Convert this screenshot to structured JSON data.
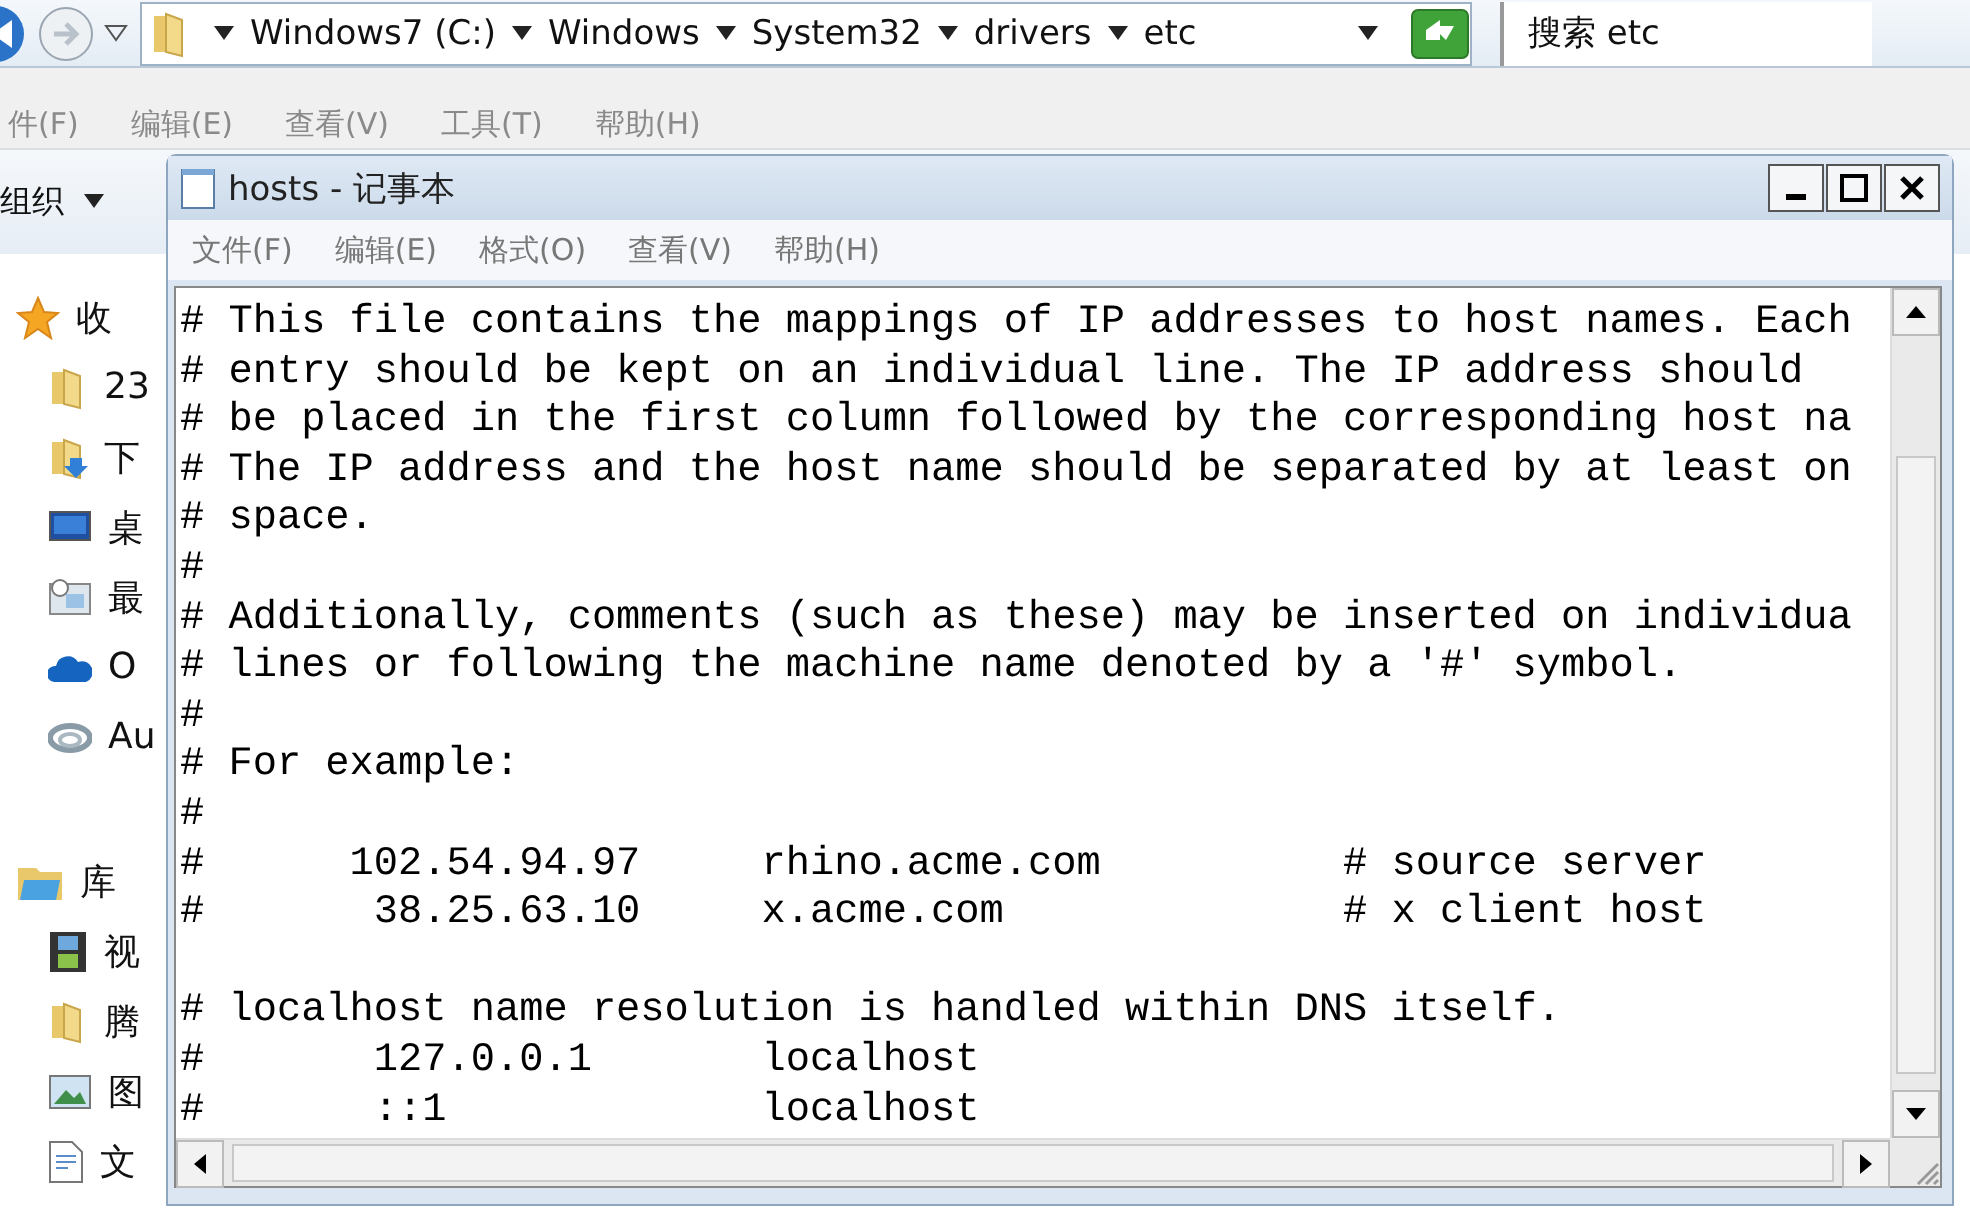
{
  "address_bar": {
    "breadcrumbs": [
      "Windows7 (C:)",
      "Windows",
      "System32",
      "drivers",
      "etc"
    ],
    "search": {
      "placeholder": "搜索 etc"
    }
  },
  "explorer_menu": [
    "件(F)",
    "编辑(E)",
    "查看(V)",
    "工具(T)",
    "帮助(H)"
  ],
  "toolbar": {
    "organize": "组织"
  },
  "sidebar": {
    "groups": [
      {
        "label": "收",
        "kind": "star",
        "items": [
          {
            "label": "23",
            "kind": "folder"
          },
          {
            "label": "下",
            "kind": "download"
          },
          {
            "label": "桌",
            "kind": "desktop"
          },
          {
            "label": "最",
            "kind": "recent"
          },
          {
            "label": "O",
            "kind": "cloud"
          },
          {
            "label": "Au",
            "kind": "swirl"
          }
        ]
      },
      {
        "label": "库",
        "kind": "library",
        "items": [
          {
            "label": "视",
            "kind": "video"
          },
          {
            "label": "腾",
            "kind": "folder"
          },
          {
            "label": "图",
            "kind": "image"
          },
          {
            "label": "文",
            "kind": "document"
          }
        ]
      }
    ]
  },
  "notepad": {
    "title": "hosts - 记事本",
    "menu": [
      "文件(F)",
      "编辑(E)",
      "格式(O)",
      "查看(V)",
      "帮助(H)"
    ],
    "blocks": [
      [
        "# This file contains the mappings of IP addresses to host names. Each",
        "# entry should be kept on an individual line. The IP address should",
        "# be placed in the first column followed by the corresponding host na",
        "# The IP address and the host name should be separated by at least on",
        "# space.",
        "#",
        "# Additionally, comments (such as these) may be inserted on individua",
        "# lines or following the machine name denoted by a '#' symbol.",
        "#",
        "# For example:",
        "#",
        "#      102.54.94.97     rhino.acme.com          # source server",
        "#       38.25.63.10     x.acme.com              # x client host"
      ],
      [
        "# localhost name resolution is handled within DNS itself.",
        "#       127.0.0.1       localhost",
        "#       ::1             localhost"
      ]
    ]
  }
}
